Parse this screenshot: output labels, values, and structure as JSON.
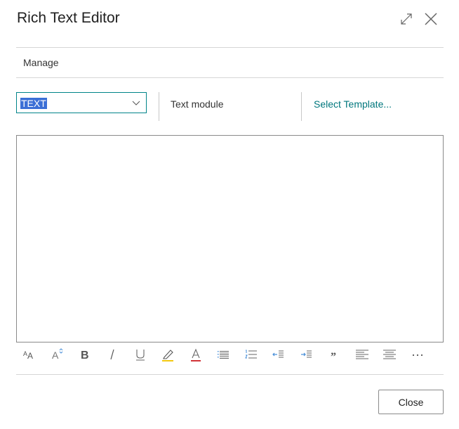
{
  "dialog": {
    "title": "Rich Text Editor",
    "header_icons": [
      "expand-icon",
      "close-icon"
    ]
  },
  "action_bar": {
    "manage_label": "Manage"
  },
  "controls": {
    "format_select": {
      "value": "TEXT",
      "selected": true
    },
    "text_module_label": "Text module",
    "select_template_link": "Select Template..."
  },
  "editor": {
    "content": ""
  },
  "toolbar": {
    "buttons": [
      {
        "name": "font-size-icon",
        "label": "Font size"
      },
      {
        "name": "change-case-icon",
        "label": "Change case"
      },
      {
        "name": "bold-icon",
        "label": "Bold"
      },
      {
        "name": "italic-icon",
        "label": "Italic"
      },
      {
        "name": "underline-icon",
        "label": "Underline"
      },
      {
        "name": "highlight-icon",
        "label": "Highlight"
      },
      {
        "name": "font-color-icon",
        "label": "Font color"
      },
      {
        "name": "bullet-list-icon",
        "label": "Bullets"
      },
      {
        "name": "numbered-list-icon",
        "label": "Numbering"
      },
      {
        "name": "decrease-indent-icon",
        "label": "Decrease indent"
      },
      {
        "name": "increase-indent-icon",
        "label": "Increase indent"
      },
      {
        "name": "quote-icon",
        "label": "Quote"
      },
      {
        "name": "align-left-icon",
        "label": "Align left"
      },
      {
        "name": "align-center-icon",
        "label": "Align center"
      },
      {
        "name": "more-icon",
        "label": "More"
      }
    ],
    "colors": {
      "highlight": "#f2c811",
      "font_color": "#d13438",
      "accent_blue": "#4a90d9"
    }
  },
  "footer": {
    "close_label": "Close"
  },
  "colors": {
    "accent": "#008489",
    "link": "#00777d",
    "selection": "#3b6fd6"
  }
}
